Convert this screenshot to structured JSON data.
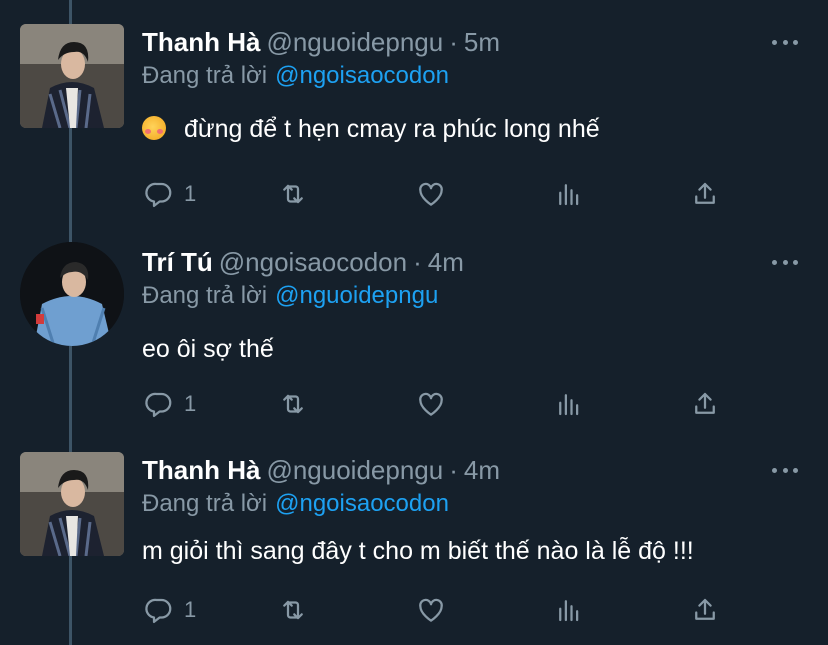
{
  "tweets": [
    {
      "name": "Thanh Hà",
      "handle": "@nguoidepngu",
      "time": "5m",
      "reply_prefix": "Đang trả lời",
      "reply_to": "@ngoisaocodon",
      "text": "đừng để t hẹn cmay ra phúc long nhế",
      "emoji": "smiling-face-with-hearts-emoji",
      "reply_count": "1"
    },
    {
      "name": "Trí Tú",
      "handle": "@ngoisaocodon",
      "time": "4m",
      "reply_prefix": "Đang trả lời",
      "reply_to": "@nguoidepngu",
      "text": "eo ôi sợ thế",
      "reply_count": "1"
    },
    {
      "name": "Thanh Hà",
      "handle": "@nguoidepngu",
      "time": "4m",
      "reply_prefix": "Đang trả lời",
      "reply_to": "@ngoisaocodon",
      "text": "m giỏi thì sang đây t cho m biết thế nào là lễ độ !!!",
      "reply_count": "1"
    }
  ],
  "separator": "·",
  "colors": {
    "background": "#15202b",
    "secondary_text": "#8899a6",
    "mention": "#1da1f2",
    "thread_line": "#3d5466"
  },
  "icons": {
    "reply": "reply-icon",
    "retweet": "retweet-icon",
    "like": "heart-icon",
    "stats": "analytics-icon",
    "share": "share-icon",
    "more": "more-dots-icon"
  }
}
